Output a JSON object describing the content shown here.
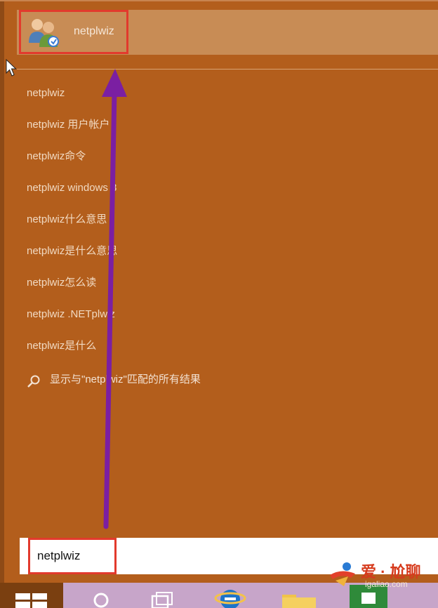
{
  "top_result": {
    "label": "netplwiz",
    "icon": "users-icon"
  },
  "suggestions": [
    "netplwiz",
    "netplwiz 用户帐户",
    "netplwiz命令",
    "netplwiz windows 8",
    "netplwiz什么意思",
    "netplwiz是什么意思",
    "netplwiz怎么读",
    "netplwiz .NETplwiz",
    "netplwiz是什么"
  ],
  "search_all": {
    "label": "显示与\"netplwiz\"匹配的所有结果",
    "icon": "search-icon"
  },
  "search_box": {
    "value": "netplwiz"
  },
  "watermark": {
    "title": "爱 · 尬聊",
    "url": "igaliao.com"
  },
  "taskbar": {
    "icons": [
      "windows-logo-icon",
      "search-icon",
      "task-view-icon",
      "internet-explorer-icon",
      "folder-icon",
      "store-icon"
    ]
  },
  "colors": {
    "background": "#b35e1c",
    "highlight_box": "#e23a2d",
    "annotation_arrow": "#7b1fa2"
  }
}
